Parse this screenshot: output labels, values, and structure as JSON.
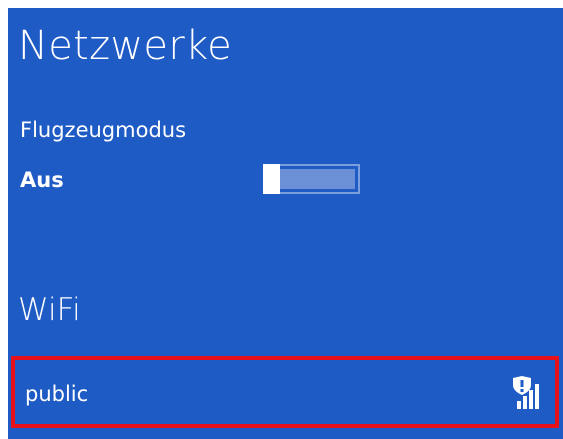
{
  "header": {
    "title": "Netzwerke"
  },
  "airplane_mode": {
    "label": "Flugzeugmodus",
    "state": "Aus",
    "enabled": false
  },
  "wifi": {
    "section_title": "WiFi",
    "networks": [
      {
        "name": "public",
        "icon": "wifi-signal-warning-icon",
        "signal_bars": 4,
        "security_warning": true
      }
    ]
  },
  "colors": {
    "panel_background": "#1f5bc4",
    "text": "#ffffff",
    "selection_border": "#e8111a",
    "toggle_track": "#6c90d6"
  }
}
